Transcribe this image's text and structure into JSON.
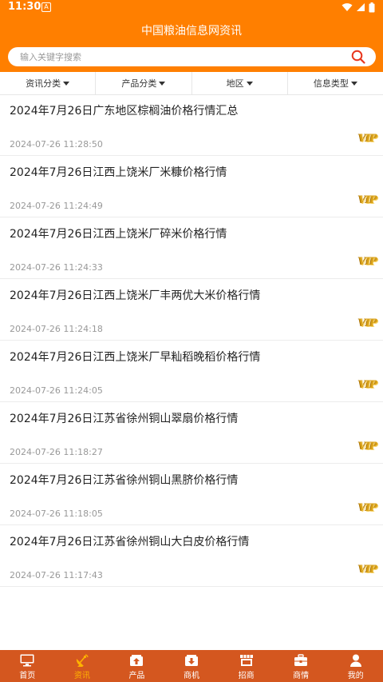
{
  "status": {
    "time": "11:30",
    "a_glyph": "A"
  },
  "header": {
    "title": "中国粮油信息网资讯"
  },
  "search": {
    "placeholder": "输入关键字搜索"
  },
  "filters": [
    "资讯分类",
    "产品分类",
    "地区",
    "信息类型"
  ],
  "items": [
    {
      "title": "2024年7月26日广东地区棕榈油价格行情汇总",
      "date": "2024-07-26 11:28:50",
      "badge": "VIP"
    },
    {
      "title": "2024年7月26日江西上饶米厂米糠价格行情",
      "date": "2024-07-26 11:24:49",
      "badge": "VIP"
    },
    {
      "title": "2024年7月26日江西上饶米厂碎米价格行情",
      "date": "2024-07-26 11:24:33",
      "badge": "VIP"
    },
    {
      "title": "2024年7月26日江西上饶米厂丰两优大米价格行情",
      "date": "2024-07-26 11:24:18",
      "badge": "VIP"
    },
    {
      "title": "2024年7月26日江西上饶米厂早籼稻晚稻价格行情",
      "date": "2024-07-26 11:24:05",
      "badge": "VIP"
    },
    {
      "title": "2024年7月26日江苏省徐州铜山翠扇价格行情",
      "date": "2024-07-26 11:18:27",
      "badge": "VIP"
    },
    {
      "title": "2024年7月26日江苏省徐州铜山黑脐价格行情",
      "date": "2024-07-26 11:18:05",
      "badge": "VIP"
    },
    {
      "title": "2024年7月26日江苏省徐州铜山大白皮价格行情",
      "date": "2024-07-26 11:17:43",
      "badge": "VIP"
    }
  ],
  "tabs": [
    {
      "label": "首页",
      "icon": "monitor-icon",
      "active": false
    },
    {
      "label": "资讯",
      "icon": "satellite-dish-icon",
      "active": true
    },
    {
      "label": "产品",
      "icon": "upload-box-icon",
      "active": false
    },
    {
      "label": "商机",
      "icon": "download-box-icon",
      "active": false
    },
    {
      "label": "招商",
      "icon": "storefront-icon",
      "active": false
    },
    {
      "label": "商情",
      "icon": "briefcase-icon",
      "active": false
    },
    {
      "label": "我的",
      "icon": "user-icon",
      "active": false
    }
  ],
  "colors": {
    "brand": "#ff7f00",
    "tabbar": "#d4571f",
    "active_tab": "#ffb300",
    "vip_gold": "#d9a21a"
  }
}
